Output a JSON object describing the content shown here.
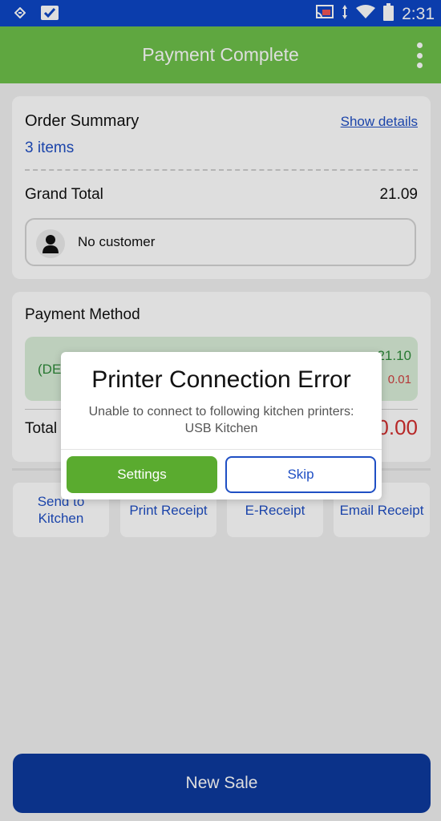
{
  "status_bar": {
    "time": "2:31"
  },
  "app_bar": {
    "title": "Payment Complete"
  },
  "order_summary": {
    "title": "Order Summary",
    "show_details": "Show details",
    "items": "3 items",
    "grand_total_label": "Grand Total",
    "grand_total_value": "21.09",
    "customer": "No customer"
  },
  "payment_method": {
    "title": "Payment Method",
    "method_label": "(DE",
    "amount": "21.10",
    "change": "0.01",
    "total_label": "Total",
    "total_value": "0.00"
  },
  "actions": {
    "send_to_kitchen": "Send to Kitchen",
    "print_receipt": "Print Receipt",
    "e_receipt": "E-Receipt",
    "email_receipt": "Email Receipt"
  },
  "new_sale": "New Sale",
  "dialog": {
    "title": "Printer Connection Error",
    "message_line1": "Unable to connect to following kitchen printers:",
    "message_line2": "USB Kitchen",
    "settings": "Settings",
    "skip": "Skip"
  },
  "colors": {
    "status_bar": "#0d47c6",
    "app_bar": "#6ec04a",
    "link": "#1f4fc4",
    "new_sale": "#0d3a9e",
    "error": "#d32f2f"
  }
}
